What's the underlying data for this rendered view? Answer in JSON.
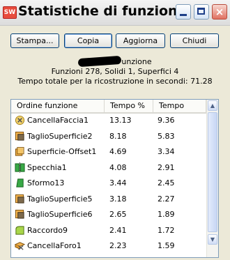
{
  "window": {
    "title": "Statistiche di funzione",
    "app_icon": "SW",
    "icons": [
      "solidworks-logo",
      "minimize-icon",
      "maximize-icon",
      "close-icon"
    ]
  },
  "buttons": {
    "stampa": "Stampa...",
    "copia": "Copia",
    "aggiorna": "Aggiorna",
    "chiudi": "Chiudi"
  },
  "summary": {
    "name_suffix": "unzione",
    "counts": "Funzioni 278, Solidi 1, Superfici 4",
    "rebuild_time": "Tempo totale per la ricostruzione in secondi: 71.28"
  },
  "table": {
    "columns": [
      "Ordine funzione",
      "Tempo %",
      "Tempo"
    ],
    "rows": [
      {
        "name": "CancellaFaccia1",
        "pct": "13.13",
        "time": "9.36",
        "icon": "delete-face-icon"
      },
      {
        "name": "TaglioSuperficie2",
        "pct": "8.18",
        "time": "5.83",
        "icon": "trim-surface-icon"
      },
      {
        "name": "Superficie-Offset1",
        "pct": "4.69",
        "time": "3.34",
        "icon": "offset-surface-icon"
      },
      {
        "name": "Specchia1",
        "pct": "4.08",
        "time": "2.91",
        "icon": "mirror-icon"
      },
      {
        "name": "Sformo13",
        "pct": "3.44",
        "time": "2.45",
        "icon": "draft-icon"
      },
      {
        "name": "TaglioSuperficie5",
        "pct": "3.18",
        "time": "2.27",
        "icon": "trim-surface-icon"
      },
      {
        "name": "TaglioSuperficie6",
        "pct": "2.65",
        "time": "1.89",
        "icon": "trim-surface-icon"
      },
      {
        "name": "Raccordo9",
        "pct": "2.41",
        "time": "1.72",
        "icon": "fillet-icon"
      },
      {
        "name": "CancellaForo1",
        "pct": "2.23",
        "time": "1.59",
        "icon": "delete-hole-icon"
      }
    ]
  },
  "scrollbar": {
    "up": "▲",
    "down": "▼"
  }
}
